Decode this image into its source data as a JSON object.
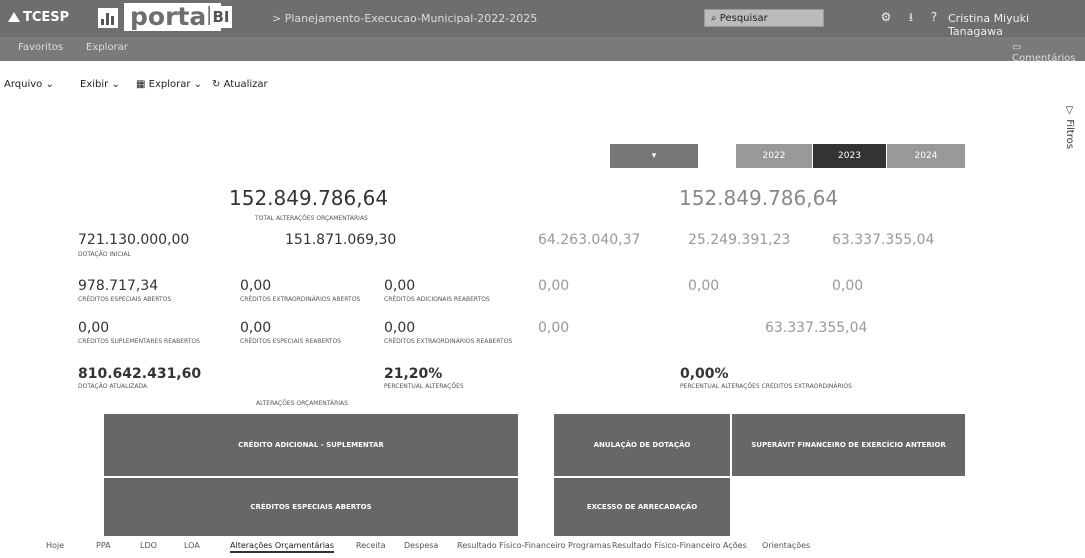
{
  "topbar": {
    "org": "TCESP",
    "portal": "portal",
    "bi": "BI",
    "report_title": "> Planejamento-Execucao-Municipal-2022-2025",
    "search": "Pesquisar",
    "user": "Cristina Miyuki Tanagawa"
  },
  "subnav": {
    "favorites": "Favoritos",
    "explore": "Explorar",
    "comments": "Comentários"
  },
  "actions": {
    "file": "Arquivo",
    "view": "Exibir",
    "explore": "Explorar",
    "refresh": "Atualizar"
  },
  "filters_label": "Filtros",
  "years": [
    "2022",
    "2023",
    "2024"
  ],
  "year_selected": "2023",
  "totals": {
    "left_value": "152.849.786,64",
    "left_label": "TOTAL ALTERAÇÕES ORÇAMENTÁRIAS",
    "right_value": "152.849.786,64"
  },
  "metrics_left": [
    {
      "value": "721.130.000,00",
      "label": "DOTAÇÃO INICIAL"
    },
    {
      "value": "151.871.069,30",
      "label": ""
    },
    {
      "value": "978.717,34",
      "label": "CRÉDITOS ESPECIAIS ABERTOS"
    },
    {
      "value": "0,00",
      "label": "CRÉDITOS EXTRAORDINÁRIOS ABERTOS"
    },
    {
      "value": "0,00",
      "label": "CRÉDITOS ADICIONAIS REABERTOS"
    },
    {
      "value": "0,00",
      "label": "CRÉDITOS SUPLEMENTARES REABERTOS"
    },
    {
      "value": "0,00",
      "label": "CRÉDITOS ESPECIAIS REABERTOS"
    },
    {
      "value": "0,00",
      "label": "CRÉDITOS EXTRAORDINÁRIOS REABERTOS"
    }
  ],
  "metrics_right": [
    {
      "value": "64.263.040,37"
    },
    {
      "value": "25.249.391,23"
    },
    {
      "value": "63.337.355,04"
    },
    {
      "value": "0,00"
    },
    {
      "value": "0,00"
    },
    {
      "value": "0,00"
    },
    {
      "value": "0,00"
    },
    {
      "value": "63.337.355,04"
    }
  ],
  "summary": {
    "updated_value": "810.642.431,60",
    "updated_label": "DOTAÇÃO ATUALIZADA",
    "percent_value": "21,20%",
    "percent_label": "PERCENTUAL ALTERAÇÕES",
    "percent2_value": "0,00%",
    "percent2_label": "PERCENTUAL ALTERAÇÕES CRÉDITOS EXTRAORDINÁRIOS"
  },
  "tiles": {
    "left_header": "ALTERAÇÕES ORÇAMENTÁRIAS",
    "t1": "CRÉDITO ADICIONAL - SUPLEMENTAR",
    "t2": "CRÉDITOS ESPECIAIS ABERTOS",
    "t3": "ANULAÇÃO DE DOTAÇÃO",
    "t4": "SUPERÁVIT FINANCEIRO DE EXERCÍCIO ANTERIOR",
    "t5": "EXCESSO DE ARRECADAÇÃO"
  },
  "tabs": [
    "Hoje",
    "PPA",
    "LDO",
    "LOA",
    "Alterações Orçamentárias",
    "Receita",
    "Despesa",
    "Resultado Físico-Financeiro Programas",
    "Resultado Físico-Financeiro Ações",
    "Orientações"
  ],
  "tab_active": "Alterações Orçamentárias",
  "colors": {
    "topbar": "#6e6e6e",
    "tile": "#676767",
    "year_selected": "#333333"
  }
}
